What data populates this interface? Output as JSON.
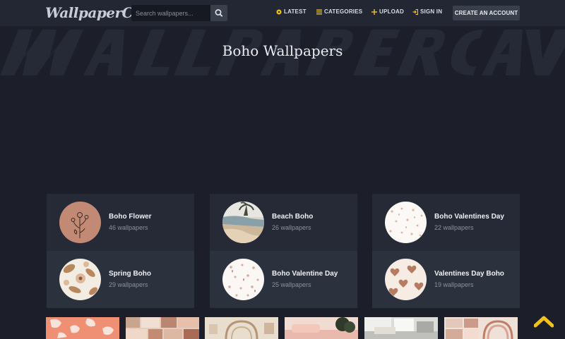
{
  "header": {
    "logo": "WallpaperCave",
    "search_placeholder": "Search wallpapers...",
    "nav": {
      "latest": "LATEST",
      "categories": "CATEGORIES",
      "upload": "UPLOAD",
      "sign_in": "SIGN IN"
    },
    "create_account": "CREATE AN ACCOUNT"
  },
  "page": {
    "title": "Boho Wallpapers"
  },
  "categories": [
    {
      "name": "Boho Flower",
      "count": "46 wallpapers"
    },
    {
      "name": "Spring Boho",
      "count": "29 wallpapers"
    },
    {
      "name": "Beach Boho",
      "count": "26 wallpapers"
    },
    {
      "name": "Boho Valentine Day",
      "count": "25 wallpapers"
    },
    {
      "name": "Boho Valentines Day",
      "count": "22 wallpapers"
    },
    {
      "name": "Valentines Day Boho",
      "count": "19 wallpapers"
    }
  ],
  "colors": {
    "background": "#1c1f2a",
    "header": "#232733",
    "accent": "#f2c21b"
  },
  "icons": {
    "latest": "sun-icon",
    "categories": "list-icon",
    "upload": "plus-icon",
    "sign_in": "sign-in-icon",
    "search": "search-icon",
    "scroll_top": "chevron-up-icon"
  }
}
